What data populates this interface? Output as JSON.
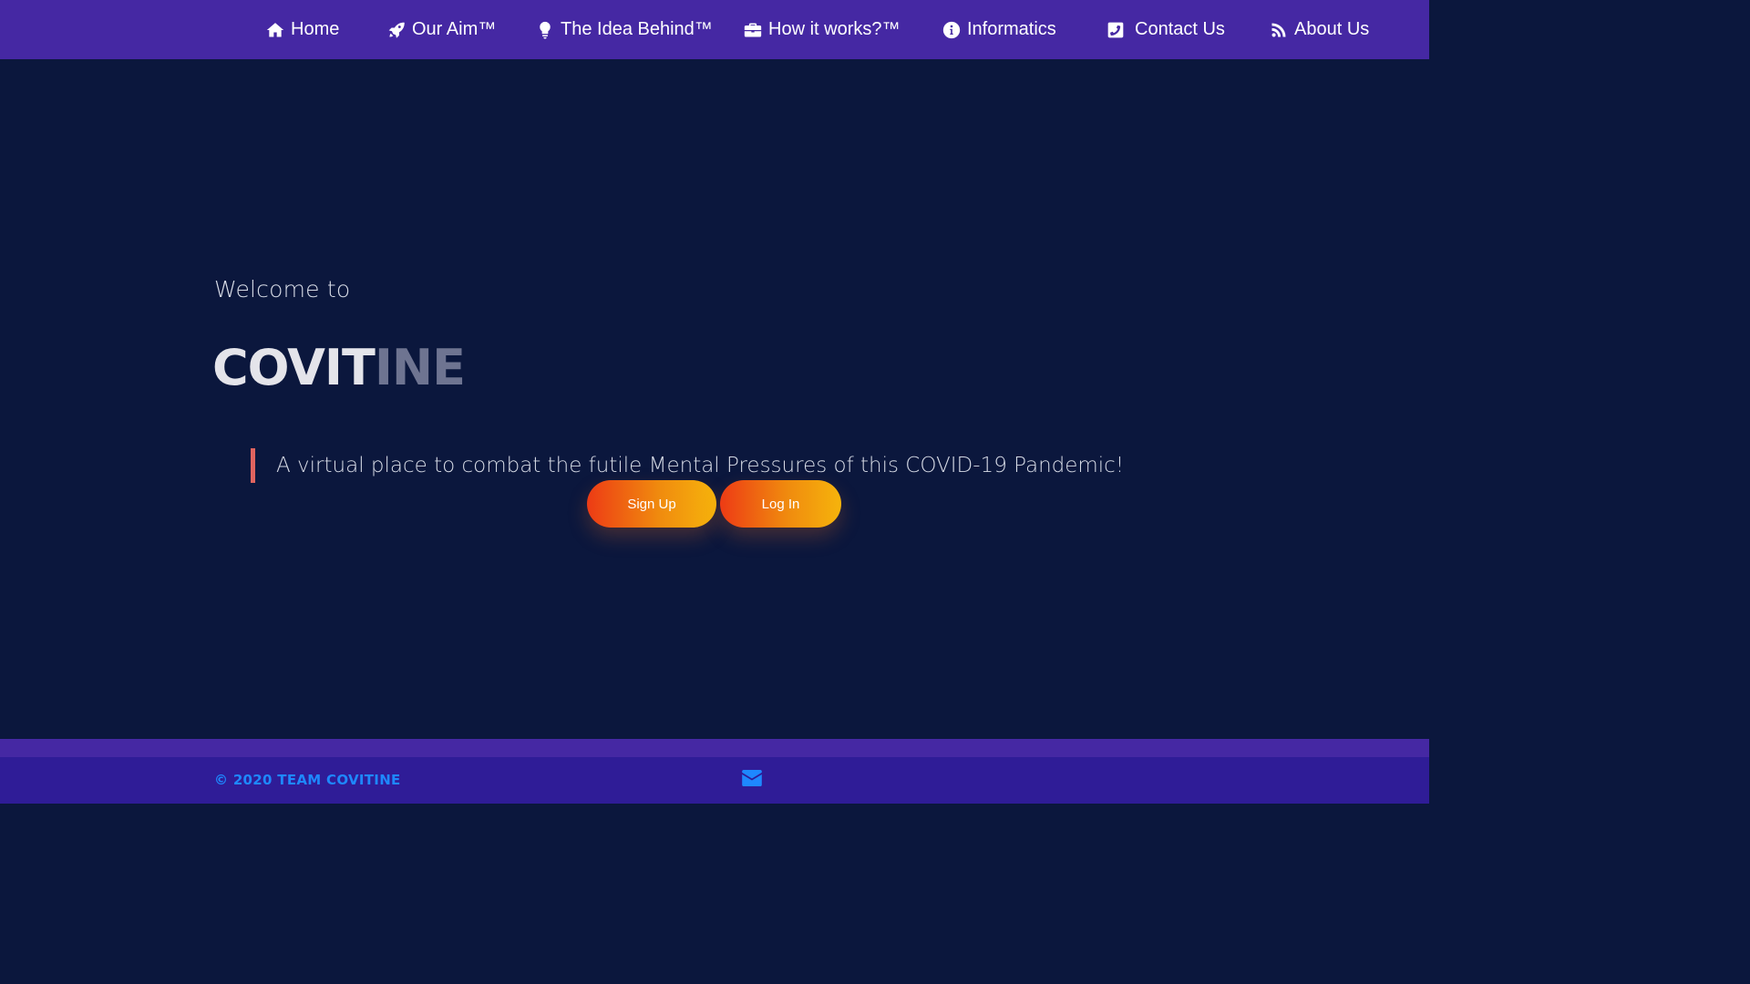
{
  "nav": {
    "items": [
      {
        "label": "Home",
        "icon": "home-icon"
      },
      {
        "label": "Our Aim™",
        "icon": "rocket-icon"
      },
      {
        "label": "The Idea Behind™",
        "icon": "lightbulb-icon"
      },
      {
        "label": "How it works?™",
        "icon": "briefcase-icon"
      },
      {
        "label": "Informatics",
        "icon": "info-circle-icon"
      },
      {
        "label": "Contact Us",
        "icon": "phone-square-icon"
      },
      {
        "label": "About Us",
        "icon": "rss-icon"
      }
    ]
  },
  "hero": {
    "welcome": "Welcome to",
    "brand_light": "COVIT",
    "brand_dark": "INE",
    "tagline": "A virtual place to combat the futile Mental Pressures of this COVID-19 Pandemic!",
    "signup_label": "Sign Up",
    "login_label": "Log In"
  },
  "footer": {
    "copyright": "© 2020 TEAM COVITINE",
    "mail_icon": "envelope-icon"
  },
  "colors": {
    "nav_bg": "#4528a3",
    "page_bg": "#0b173d",
    "footer_bg": "#2f1c97",
    "accent_blue": "#1e88ff",
    "quote_bar": "#e0645f",
    "button_gradient_start": "#ed3b15",
    "button_gradient_end": "#f6b40c"
  }
}
